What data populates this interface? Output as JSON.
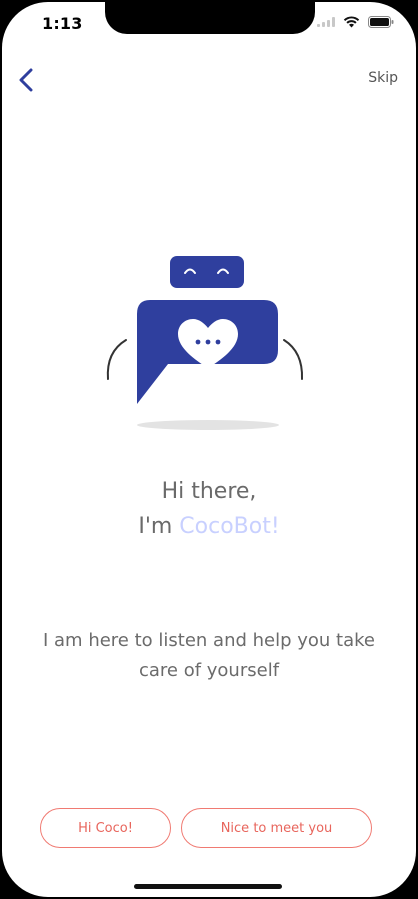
{
  "status_bar": {
    "time": "1:13",
    "icons": [
      "cellular-signal-icon",
      "wifi-icon",
      "battery-icon"
    ]
  },
  "nav": {
    "back_icon": "chevron-left-icon",
    "skip_label": "Skip"
  },
  "mascot": {
    "name": "robot-chat-bubble-illustration",
    "colors": {
      "body": "#2f3f9e",
      "heart": "#ffffff",
      "shadow": "#e3e3e3"
    }
  },
  "headline": {
    "line1": "Hi there,",
    "line2_prefix": "I'm ",
    "bot_name": "CocoBot!"
  },
  "intro_text": "I am here to listen and help you take care of yourself",
  "quick_replies": [
    "Hi Coco!",
    "Nice to meet you"
  ],
  "colors": {
    "accent": "#2f3f9e",
    "reply_border": "#f07a72",
    "reply_text": "#e8655c",
    "bot_name": "#c8d0ff"
  }
}
